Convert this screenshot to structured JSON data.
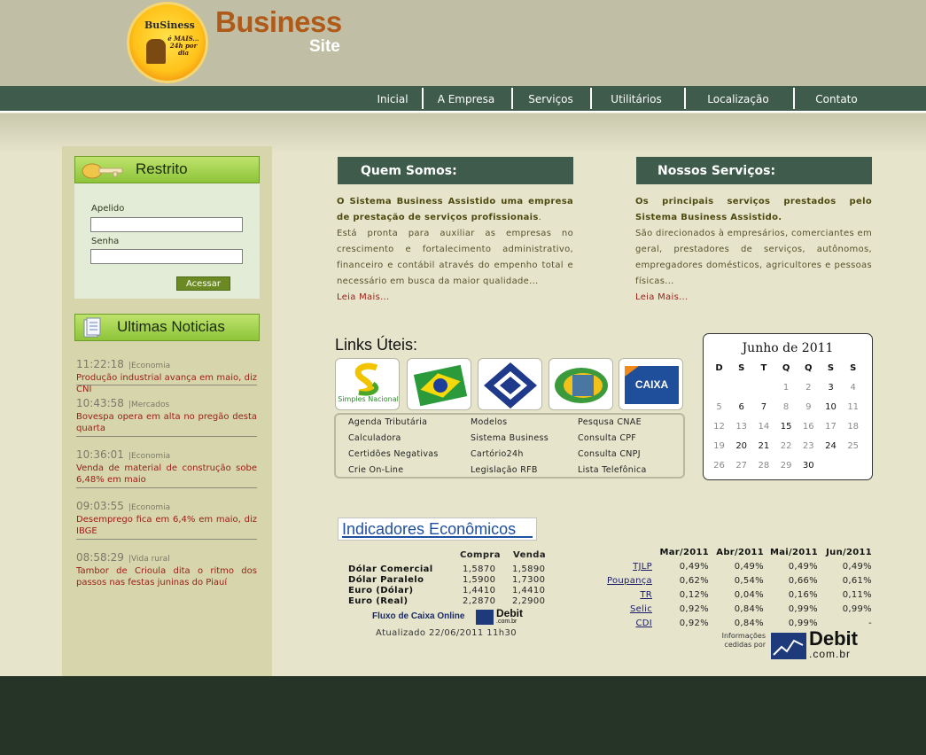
{
  "brand": {
    "logo_word": "BuSiness",
    "logo_tag": "é MAIS... 24h por dia",
    "title": "Business",
    "subtitle": "Site"
  },
  "nav": [
    "Inicial",
    "A Empresa",
    "Serviços",
    "Utilitários",
    "Localização",
    "Contato"
  ],
  "login": {
    "title": "Restrito",
    "apelido_label": "Apelido",
    "senha_label": "Senha",
    "button": "Acessar"
  },
  "news": {
    "title": "Ultimas Noticias",
    "items": [
      {
        "time": "11:22:18",
        "category": "|Economia",
        "headline": "Produção industrial avança em maio, diz CNI"
      },
      {
        "time": "10:43:58",
        "category": "|Mercados",
        "headline": "Bovespa opera em alta no pregão desta quarta"
      },
      {
        "time": "10:36:01",
        "category": "|Economia",
        "headline": "Venda de material de construção sobe 6,48% em maio"
      },
      {
        "time": "09:03:55",
        "category": "|Economia",
        "headline": "Desemprego fica em 6,4% em maio, diz IBGE"
      },
      {
        "time": "08:58:29",
        "category": "|Vida rural",
        "headline": "Tambor de Crioula dita o ritmo dos passos nas festas juninas do Piauí"
      }
    ]
  },
  "about": {
    "title": "Quem Somos:",
    "lead": "O Sistema Business Assistido  uma empresa de prestação de serviços profissionais",
    "body": "Está pronta para auxiliar as empresas no crescimento e fortalecimento administrativo, financeiro e contábil através do empenho total e necessário em busca da maior qualidade...",
    "more": "Leia Mais..."
  },
  "services": {
    "title": "Nossos Serviços:",
    "lead": "Os principais serviços prestados pelo Sistema Business Assistido.",
    "body": "São direcionados à empresários, comerciantes em geral, prestadores de serviços, autônomos, empregadores domésticos, agricultores e pessoas físicas...",
    "more": "Leia Mais..."
  },
  "links": {
    "title": "Links Úteis:",
    "logos": [
      "Simples Nacional",
      "Brasil",
      "Receita Federal",
      "INSS",
      "CAIXA"
    ],
    "col1": [
      "Agenda Tributária",
      "Calculadora",
      "Certidões Negativas",
      "Crie On-Line"
    ],
    "col2": [
      "Modelos",
      "Sistema Business",
      "Cartório24h",
      "Legislação RFB"
    ],
    "col3": [
      "Pesqusa CNAE",
      "Consulta CPF",
      "Consulta CNPJ",
      "Lista Telefônica"
    ]
  },
  "calendar": {
    "title": "Junho de 2011",
    "weekdays": [
      "D",
      "S",
      "T",
      "Q",
      "Q",
      "S",
      "S"
    ],
    "weeks": [
      [
        "",
        "",
        "",
        "1",
        "2",
        "3",
        "4"
      ],
      [
        "5",
        "6",
        "7",
        "8",
        "9",
        "10",
        "11"
      ],
      [
        "12",
        "13",
        "14",
        "15",
        "16",
        "17",
        "18"
      ],
      [
        "19",
        "20",
        "21",
        "22",
        "23",
        "24",
        "25"
      ],
      [
        "26",
        "27",
        "28",
        "29",
        "30",
        "",
        ""
      ]
    ],
    "highlighted_days": [
      "3",
      "6",
      "7",
      "10",
      "15",
      "20",
      "21",
      "24",
      "30"
    ]
  },
  "indicators": {
    "title": "Indicadores Econômicos",
    "currency_headers": [
      "Compra",
      "Venda"
    ],
    "currencies": [
      {
        "name": "Dólar Comercial",
        "buy": "1,5870",
        "sell": "1,5890"
      },
      {
        "name": "Dólar Paralelo",
        "buy": "1,5900",
        "sell": "1,7300"
      },
      {
        "name": "Euro (Dólar)",
        "buy": "1,4410",
        "sell": "1,4410"
      },
      {
        "name": "Euro (Real)",
        "buy": "2,2870",
        "sell": "2,2900"
      }
    ],
    "fluxo_label": "Fluxo de Caixa Online",
    "debit_small": "Debit",
    "debit_small_sub": ".com.br",
    "updated": "Atualizado 22/06/2011 11h30",
    "months": [
      "Mar/2011",
      "Abr/2011",
      "Mai/2011",
      "Jun/2011"
    ],
    "rates": [
      {
        "name": "TJLP",
        "values": [
          "0,49%",
          "0,49%",
          "0,49%",
          "0,49%"
        ]
      },
      {
        "name": "Poupança",
        "values": [
          "0,62%",
          "0,54%",
          "0,66%",
          "0,61%"
        ]
      },
      {
        "name": "TR",
        "values": [
          "0,12%",
          "0,04%",
          "0,16%",
          "0,11%"
        ]
      },
      {
        "name": "Selic",
        "values": [
          "0,92%",
          "0,84%",
          "0,99%",
          "0,99%"
        ]
      },
      {
        "name": "CDI",
        "values": [
          "0,92%",
          "0,84%",
          "0,99%",
          "-"
        ]
      }
    ],
    "credit_line1": "Informações",
    "credit_line2": "cedidas por",
    "debit_big": "Debit",
    "debit_big_sub": ".com.br"
  },
  "colors": {
    "nav_bg": "#3e5b4c",
    "page_bg": "#e6e5cc",
    "sidebar_bg": "#d6d5ab",
    "link_red": "#9b1d17",
    "footer_bg": "#253427"
  }
}
